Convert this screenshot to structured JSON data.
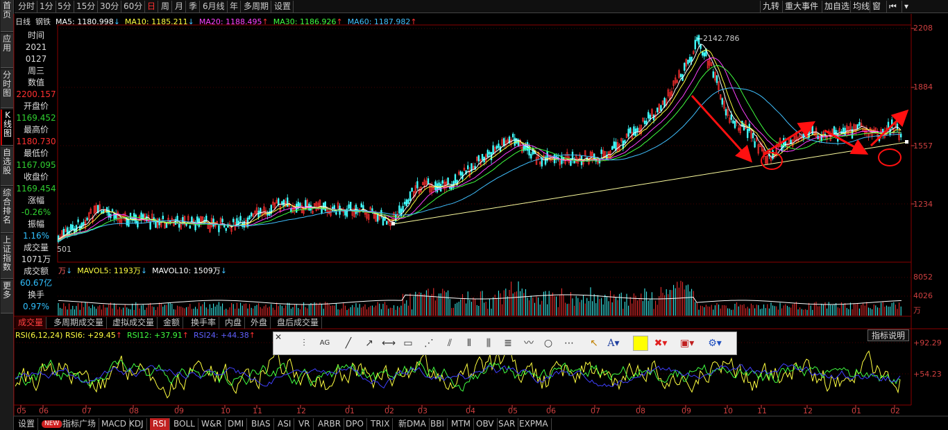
{
  "left_nav": [
    "首页",
    "应用",
    "分时图",
    "K线图",
    "自选股",
    "综合排名",
    "上证指数",
    "更多"
  ],
  "top_tabs": [
    "分时",
    "1分",
    "5分",
    "15分",
    "30分",
    "60分",
    "日",
    "周",
    "月",
    "季",
    "6月线",
    "年",
    "多周期",
    "设置"
  ],
  "top_right": [
    "九转",
    "重大事件",
    "加自选",
    "均线",
    "窗"
  ],
  "ma_row": {
    "kind": "日线",
    "name": "钢铁",
    "ma5": "MA5: 1180.998",
    "ma10": "MA10: 1185.211",
    "ma20": "MA20: 1188.495",
    "ma30": "MA30: 1186.926",
    "ma60": "MA60: 1187.982"
  },
  "info_panel": [
    {
      "t": "时间",
      "c": "#ddd"
    },
    {
      "t": "2021",
      "c": "#ddd"
    },
    {
      "t": "0127",
      "c": "#ddd"
    },
    {
      "t": "周三",
      "c": "#ddd"
    },
    {
      "t": "数值",
      "c": "#ddd"
    },
    {
      "t": "2200.157",
      "c": "#ff3030"
    },
    {
      "t": "开盘价",
      "c": "#ddd"
    },
    {
      "t": "1169.452",
      "c": "#30d030"
    },
    {
      "t": "最高价",
      "c": "#ddd"
    },
    {
      "t": "1180.730",
      "c": "#ff3030"
    },
    {
      "t": "最低价",
      "c": "#ddd"
    },
    {
      "t": "1167.095",
      "c": "#30d030"
    },
    {
      "t": "收盘价",
      "c": "#ddd"
    },
    {
      "t": "1169.454",
      "c": "#30d030"
    },
    {
      "t": "涨幅",
      "c": "#ddd"
    },
    {
      "t": "-0.26%",
      "c": "#30d030"
    },
    {
      "t": "振幅",
      "c": "#ddd"
    },
    {
      "t": "1.16%",
      "c": "#30c0ff"
    },
    {
      "t": "成交量",
      "c": "#ddd"
    },
    {
      "t": "1071万",
      "c": "#ddd"
    },
    {
      "t": "成交额",
      "c": "#ddd"
    },
    {
      "t": "60.67亿",
      "c": "#30c0ff"
    },
    {
      "t": "换手",
      "c": "#ddd"
    },
    {
      "t": "0.97%",
      "c": "#30c0ff"
    }
  ],
  "price_axis": [
    "2208",
    "1884",
    "1557",
    "1234"
  ],
  "peak_label": "2142.786",
  "low_label": "501",
  "vol_row": {
    "unit": "万",
    "mavol5": "MAVOL5: 1193万",
    "mavol10": "MAVOL10: 1509万"
  },
  "vol_axis": [
    "8052",
    "4026",
    "万"
  ],
  "vol_tabs": [
    "成交量",
    "多周期成交量",
    "虚拟成交量",
    "金额",
    "换手率",
    "内盘",
    "外盘",
    "盘后成交量"
  ],
  "rsi_row": {
    "title": "RSI(6,12,24)",
    "rsi6": "RSI6: +29.45",
    "rsi12": "RSI12: +37.91",
    "rsi24": "RSI24: +44.38"
  },
  "rsi_axis": [
    "+92.29",
    "+54.23"
  ],
  "indicator_help": "指标说明",
  "x_axis": [
    "05",
    "06",
    "07",
    "08",
    "09",
    "10",
    "11",
    "12",
    "01",
    "02",
    "03",
    "04",
    "05",
    "06",
    "07",
    "08",
    "09",
    "10",
    "11",
    "12",
    "01",
    "02"
  ],
  "bottom_tabs": [
    "设置",
    "NEW",
    "指标广场",
    "MACD",
    "KDJ",
    "RSI",
    "BOLL",
    "W&R",
    "DMI",
    "BIAS",
    "ASI",
    "VR",
    "ARBR",
    "DPO",
    "TRIX",
    "新DMA",
    "BBI",
    "MTM",
    "OBV",
    "SAR",
    "EXPMA"
  ],
  "colors": {
    "ma5": "#ffffff",
    "ma10": "#ffff40",
    "ma20": "#ff40ff",
    "ma30": "#40ff40",
    "ma60": "#40c0ff",
    "up": "#ff3030",
    "down": "#40ffff",
    "annot": "#ff1010"
  }
}
